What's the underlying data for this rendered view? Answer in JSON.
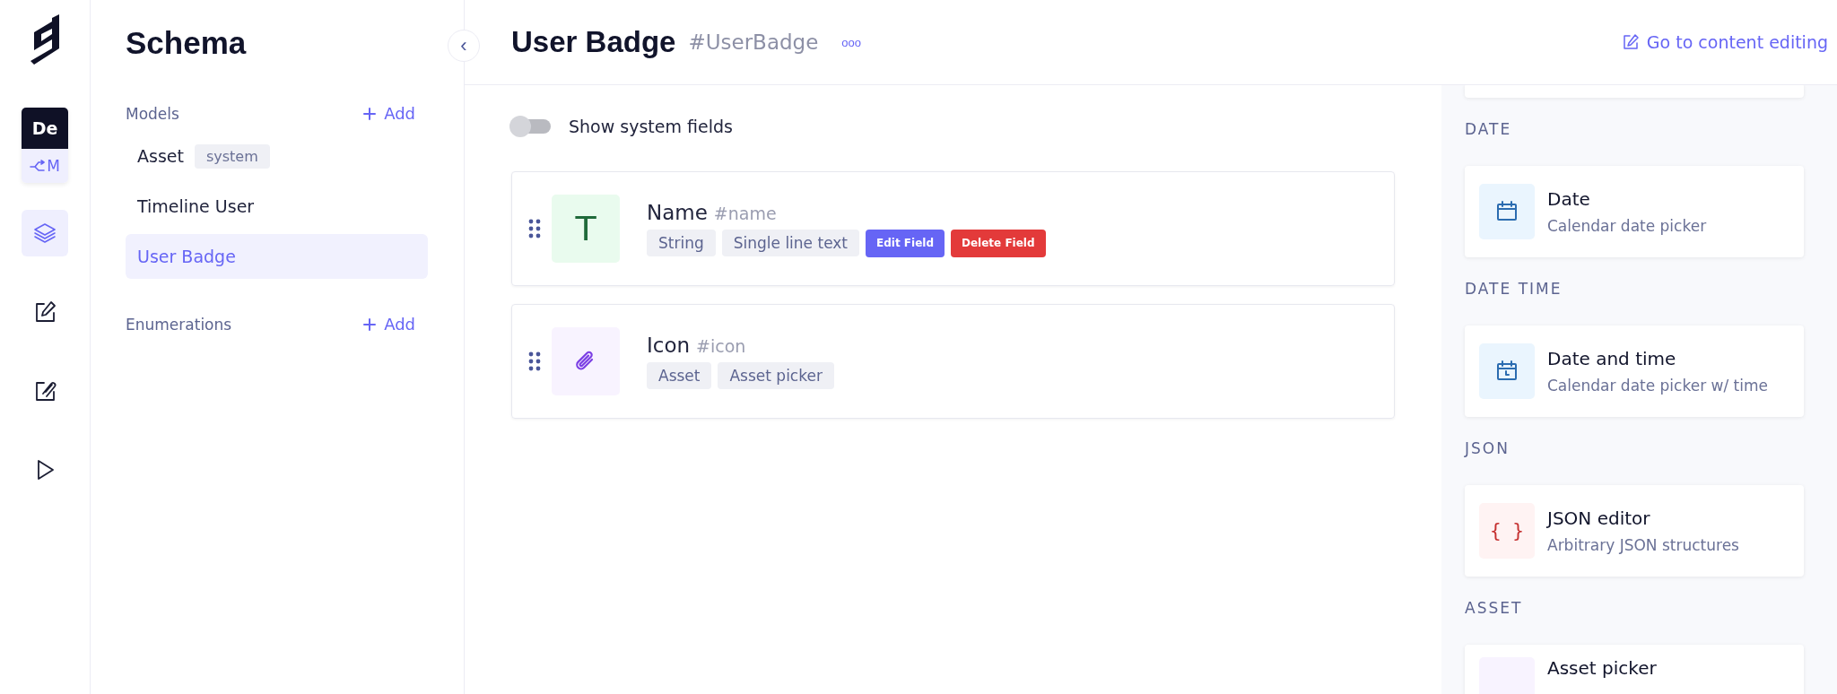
{
  "rail": {
    "workspace": {
      "initials": "De",
      "branch": "M"
    },
    "items": [
      {
        "kind": "layers",
        "selected": true
      },
      {
        "kind": "edit",
        "selected": false
      },
      {
        "kind": "edit-clip",
        "selected": false
      },
      {
        "kind": "play",
        "selected": false
      }
    ]
  },
  "sidebar": {
    "title": "Schema",
    "collapse_icon": "‹",
    "sections": [
      {
        "title": "Models",
        "add_label": "Add",
        "items": [
          {
            "label": "Asset",
            "tag": "system",
            "selected": false
          },
          {
            "label": "Timeline User",
            "selected": false
          },
          {
            "label": "User Badge",
            "selected": true
          }
        ]
      },
      {
        "title": "Enumerations",
        "add_label": "Add"
      }
    ]
  },
  "header": {
    "title": "User Badge",
    "api_id": "#UserBadge",
    "more": "ooo",
    "link": "Go to content editing"
  },
  "toggle": {
    "label": "Show system fields",
    "on": false
  },
  "fields": [
    {
      "kind": "text",
      "icon": "T",
      "name": "Name",
      "api_id": "#name",
      "tags": [
        "String",
        "Single line text"
      ],
      "actions": [
        {
          "kind": "edit",
          "label": "Edit Field"
        },
        {
          "kind": "delete",
          "label": "Delete Field"
        }
      ]
    },
    {
      "kind": "asset",
      "name": "Icon",
      "api_id": "#icon",
      "tags": [
        "Asset",
        "Asset picker"
      ]
    }
  ],
  "field_types": [
    {
      "section": "DATE",
      "kind": "date",
      "title": "Date",
      "description": "Calendar date picker"
    },
    {
      "section": "DATE TIME",
      "kind": "datetime",
      "title": "Date and time",
      "description": "Calendar date picker w/ time"
    },
    {
      "section": "JSON",
      "kind": "json",
      "icon": "{ }",
      "title": "JSON editor",
      "description": "Arbitrary JSON structures"
    },
    {
      "section": "ASSET",
      "kind": "asset",
      "title": "Asset picker"
    }
  ]
}
